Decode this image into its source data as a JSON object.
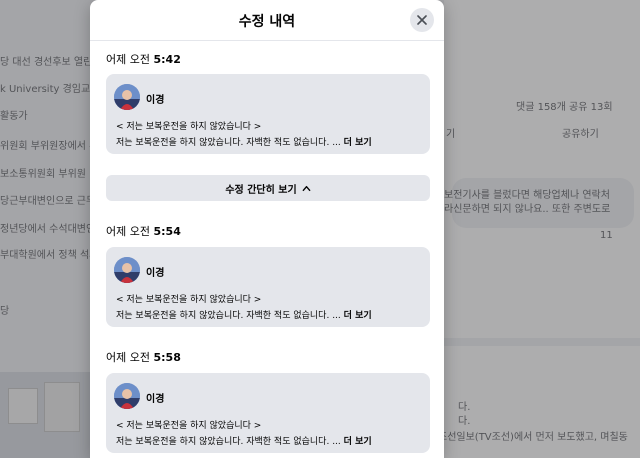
{
  "background": {
    "left_lines": [
      "당 대선 경선후보 열린",
      "k University 경임교수",
      "활동가",
      "위원회 부위원장에서 부",
      "보소통위원회 부위원",
      "당근부대변인으로 근무",
      "정년당에서 수석대변인",
      "부대학원에서 정책 석사",
      "당"
    ],
    "right_texts": {
      "stats": "댓글 158개   공유 13회",
      "like": "기",
      "share": "공유하기",
      "comment_line1": "보전기사를 블렀다면 해당업체나 연락처",
      "comment_line2": "라신문하면 되지 않나요.. 또한 주변도로",
      "comment_count": "11",
      "card_line1": "다.",
      "card_line2": "다.",
      "card_line3": "조선일보(TV조선)에서 먼저 보도했고, 며칠동"
    }
  },
  "modal": {
    "title": "수정 내역",
    "close_icon": "close-icon",
    "collapse_label": "수정 간단히 보기",
    "entries": [
      {
        "time_prefix": "어제 오전",
        "time": "5:42",
        "author": "이경",
        "line1": "< 저는 보복운전을 하지 않았습니다 >",
        "line2": "저는 보복운전을 하지 않았습니다. 자백한 적도 없습니다. ...",
        "more": "더 보기"
      },
      {
        "time_prefix": "어제 오전",
        "time": "5:54",
        "author": "이경",
        "line1": "< 저는 보복운전을 하지 않았습니다 >",
        "line2": "저는 보복운전을 하지 않았습니다. 자백한 적도 없습니다. ...",
        "more": "더 보기"
      },
      {
        "time_prefix": "어제 오전",
        "time": "5:58",
        "author": "이경",
        "line1": "< 저는 보복운전을 하지 않았습니다 >",
        "line2": "저는 보복운전을 하지 않았습니다. 자백한 적도 없습니다. ...",
        "more": "더 보기"
      }
    ]
  }
}
